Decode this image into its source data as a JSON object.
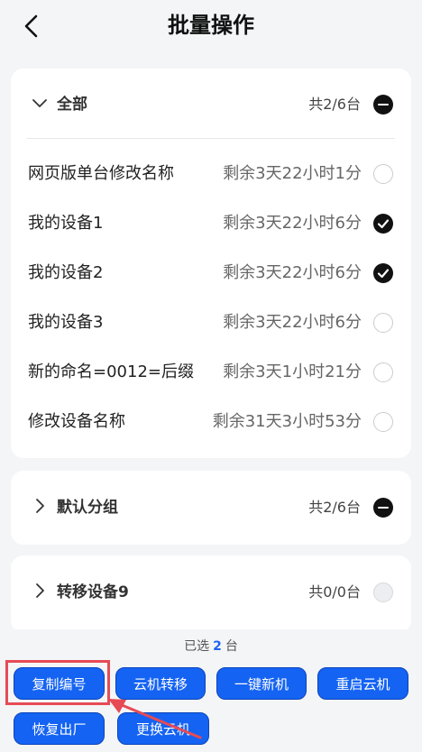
{
  "header": {
    "title": "批量操作"
  },
  "groups": [
    {
      "title": "全部",
      "count": "共2/6台",
      "state": "partial",
      "expanded": true,
      "devices": [
        {
          "name": "网页版单台修改名称",
          "remain": "剩余3天22小时1分",
          "checked": false
        },
        {
          "name": "我的设备1",
          "remain": "剩余3天22小时6分",
          "checked": true
        },
        {
          "name": "我的设备2",
          "remain": "剩余3天22小时6分",
          "checked": true
        },
        {
          "name": "我的设备3",
          "remain": "剩余3天22小时6分",
          "checked": false
        },
        {
          "name": "新的命名=0012=后缀",
          "remain": "剩余3天1小时21分",
          "checked": false
        },
        {
          "name": "修改设备名称",
          "remain": "剩余31天3小时53分",
          "checked": false
        }
      ]
    },
    {
      "title": "默认分组",
      "count": "共2/6台",
      "state": "partial",
      "expanded": false
    },
    {
      "title": "转移设备9",
      "count": "共0/0台",
      "state": "empty",
      "expanded": false
    }
  ],
  "footer": {
    "selected_prefix": "已选",
    "selected_count": "2",
    "selected_suffix": "台",
    "buttons": [
      {
        "label": "复制编号",
        "highlighted": true
      },
      {
        "label": "云机转移"
      },
      {
        "label": "一键新机"
      },
      {
        "label": "重启云机"
      },
      {
        "label": "恢复出厂"
      },
      {
        "label": "更换云机"
      }
    ]
  },
  "colors": {
    "accent_blue": "#1463f3",
    "highlight_red": "#e64b55",
    "check_black": "#111111",
    "page_bg": "#f4f5f7"
  }
}
